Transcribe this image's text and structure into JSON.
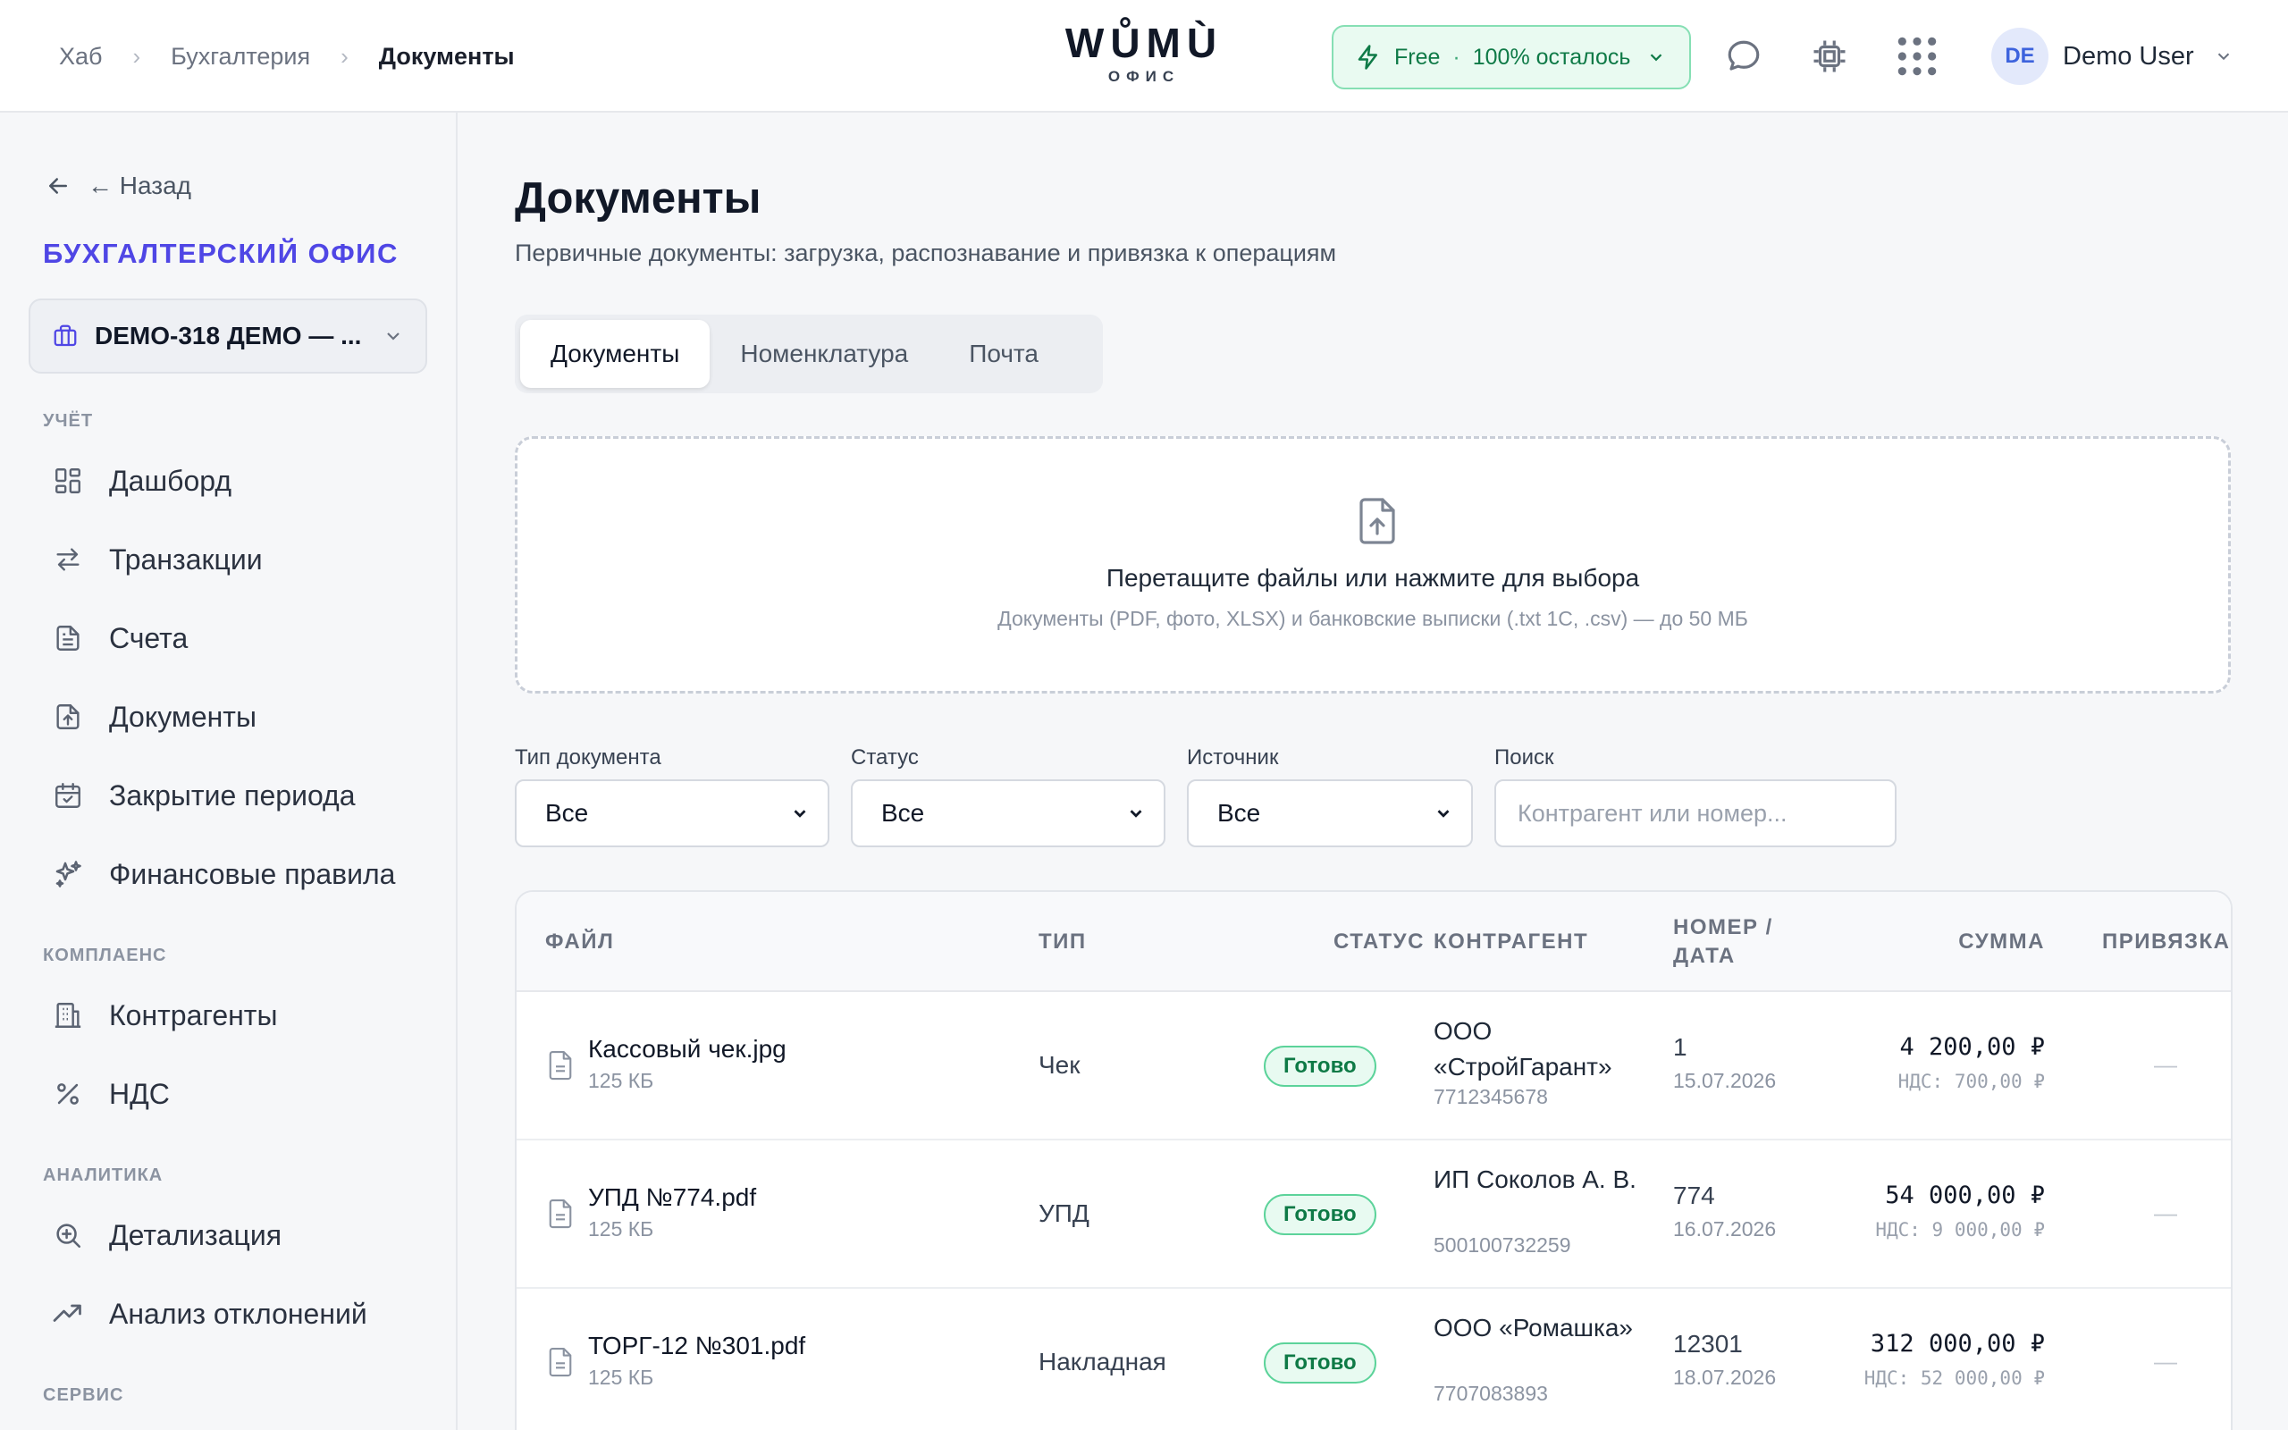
{
  "header": {
    "breadcrumbs": [
      "Хаб",
      "Бухгалтерия",
      "Документы"
    ],
    "logo": {
      "mark": "WŮMÙ",
      "sub": "ОФИС"
    },
    "plan": {
      "name": "Free",
      "remaining": "100% осталось"
    },
    "user": {
      "initials": "DE",
      "name": "Demo User"
    }
  },
  "sidebar": {
    "back_label": "← Назад",
    "title": "БУХГАЛТЕРСКИЙ ОФИС",
    "org_selector": "DEMO-318 ДЕМО — ...",
    "sections": {
      "accounting": "УЧЁТ",
      "compliance": "КОМПЛАЕНС",
      "analytics": "АНАЛИТИКА",
      "service": "СЕРВИС"
    },
    "items": [
      {
        "label": "Дашборд",
        "icon": "dashboard-icon"
      },
      {
        "label": "Транзакции",
        "icon": "transfer-arrows-icon"
      },
      {
        "label": "Счета",
        "icon": "file-text-icon"
      },
      {
        "label": "Документы",
        "icon": "file-upload-icon"
      },
      {
        "label": "Закрытие периода",
        "icon": "calendar-check-icon"
      },
      {
        "label": "Финансовые правила",
        "icon": "sparkles-icon"
      },
      {
        "label": "Контрагенты",
        "icon": "building-icon"
      },
      {
        "label": "НДС",
        "icon": "percent-icon"
      },
      {
        "label": "Детализация",
        "icon": "zoom-in-icon"
      },
      {
        "label": "Анализ отклонений",
        "icon": "trending-up-icon"
      }
    ]
  },
  "main": {
    "title": "Документы",
    "subtitle": "Первичные документы: загрузка, распознавание и привязка к операциям",
    "tabs": [
      "Документы",
      "Номенклатура",
      "Почта"
    ],
    "active_tab": "Документы",
    "dropzone": {
      "title": "Перетащите файлы или нажмите для выбора",
      "hint": "Документы (PDF, фото, XLSX) и банковские выписки (.txt 1С, .csv) — до 50 МБ"
    },
    "filters": {
      "doc_type": {
        "label": "Тип документа",
        "value": "Все"
      },
      "status": {
        "label": "Статус",
        "value": "Все"
      },
      "source": {
        "label": "Источник",
        "value": "Все"
      },
      "search": {
        "label": "Поиск",
        "placeholder": "Контрагент или номер..."
      }
    },
    "table": {
      "columns": {
        "file": "ФАЙЛ",
        "type": "ТИП",
        "status": "СТАТУС",
        "counterparty": "КОНТРАГЕНТ",
        "number_date_1": "НОМЕР /",
        "number_date_2": "ДАТА",
        "amount": "СУММА",
        "link": "ПРИВЯЗКА"
      },
      "rows": [
        {
          "file": "Кассовый чек.jpg",
          "size": "125 КБ",
          "type": "Чек",
          "status": "Готово",
          "counterparty": "ООО «СтройГарант»",
          "inn": "7712345678",
          "number": "1",
          "date": "15.07.2026",
          "amount": "4 200,00 ₽",
          "vat": "НДС: 700,00 ₽",
          "link": "—"
        },
        {
          "file": "УПД №774.pdf",
          "size": "125 КБ",
          "type": "УПД",
          "status": "Готово",
          "counterparty": "ИП Соколов А. В.",
          "inn": "500100732259",
          "number": "774",
          "date": "16.07.2026",
          "amount": "54 000,00 ₽",
          "vat": "НДС: 9 000,00 ₽",
          "link": "—"
        },
        {
          "file": "ТОРГ-12 №301.pdf",
          "size": "125 КБ",
          "type": "Накладная",
          "status": "Готово",
          "counterparty": "ООО «Ромашка»",
          "inn": "7707083893",
          "number": "12301",
          "date": "18.07.2026",
          "amount": "312 000,00 ₽",
          "vat": "НДС: 52 000,00 ₽",
          "link": "—"
        }
      ]
    }
  },
  "colors": {
    "accent": "#4f46e5",
    "success": "#0e7a46",
    "success_bg": "#e8faf1",
    "avatar": "#3d63dd"
  }
}
